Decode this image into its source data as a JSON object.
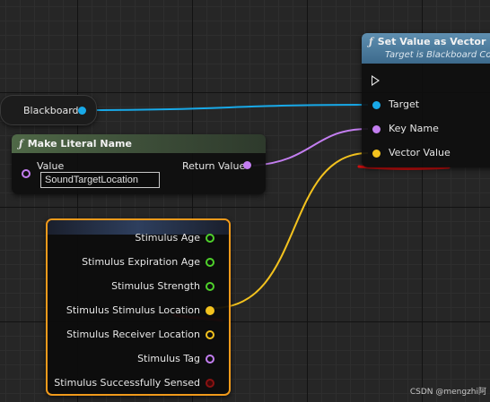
{
  "colors": {
    "object_pin": "#18a9e8",
    "name_pin": "#c37ef0",
    "vector_pin": "#f3c21e",
    "bool_pin": "#8a1212",
    "float_pin": "#4fd12b",
    "selection_border": "#f19a1b",
    "annotation": "#d80f0f"
  },
  "blackboard_node": {
    "label": "Blackboard",
    "pin_icon": "object-pin-icon"
  },
  "make_literal_name_node": {
    "icon": "function-icon",
    "title": "Make Literal Name",
    "input_label": "Value",
    "input_value": "SoundTargetLocation",
    "output_label": "Return Value"
  },
  "set_value_node": {
    "icon": "function-icon",
    "title": "Set Value as Vector",
    "subtitle": "Target is Blackboard Co",
    "pins": [
      {
        "label": "Target",
        "type": "object"
      },
      {
        "label": "Key Name",
        "type": "name"
      },
      {
        "label": "Vector Value",
        "type": "vector"
      }
    ]
  },
  "break_stimulus_node": {
    "pins": [
      {
        "label": "Stimulus Age",
        "type": "float"
      },
      {
        "label": "Stimulus Expiration Age",
        "type": "float"
      },
      {
        "label": "Stimulus Strength",
        "type": "float"
      },
      {
        "label": "Stimulus Stimulus Location",
        "type": "vector"
      },
      {
        "label": "Stimulus Receiver Location",
        "type": "vector"
      },
      {
        "label": "Stimulus Tag",
        "type": "name"
      },
      {
        "label": "Stimulus Successfully Sensed",
        "type": "bool"
      }
    ]
  },
  "watermark": "CSDN @mengzhi阿"
}
